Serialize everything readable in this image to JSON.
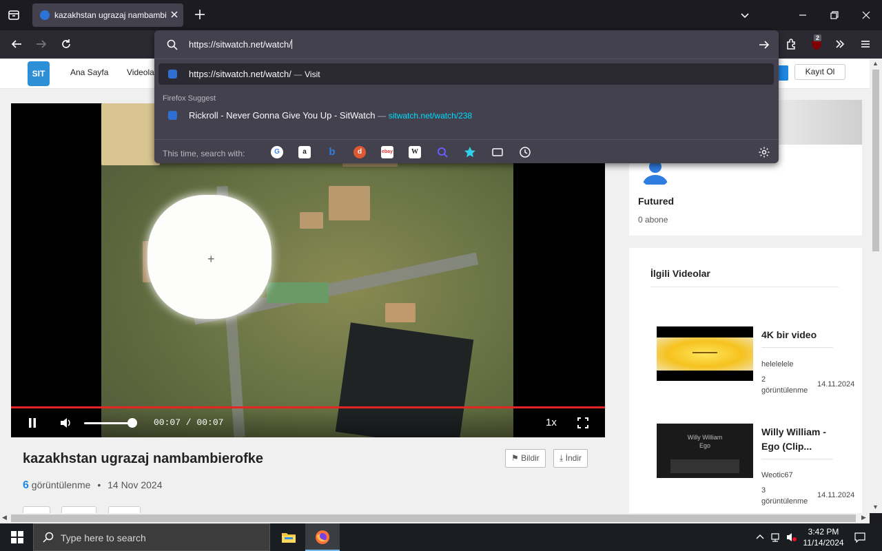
{
  "browser": {
    "tab_title": "kazakhstan ugrazaj nambambierofke",
    "url": "https://sitwatch.net/watch/",
    "extension_badge": "2",
    "results": {
      "visit_url": "https://sitwatch.net/watch/",
      "visit_action": "Visit",
      "suggest_heading": "Firefox Suggest",
      "suggest_title": "Rickroll - Never Gonna Give You Up - SitWatch",
      "suggest_url": "sitwatch.net/watch/238",
      "search_with_label": "This time, search with:"
    }
  },
  "site": {
    "logo_text": "SIT",
    "nav": [
      "Ana Sayfa",
      "Videolar"
    ],
    "register_button": "Kayıt Ol"
  },
  "video": {
    "time": "00:07 / 00:07",
    "speed": "1x",
    "progress": 1.0,
    "volume": 0.9,
    "title": "kazakhstan ugrazaj nambambierofke",
    "report_button": "Bildir",
    "download_button": "İndir",
    "views_count": "6",
    "views_label": "görüntülenme",
    "separator": "•",
    "date": "14 Nov 2024"
  },
  "channel": {
    "name": "Futured",
    "subscribers": "0 abone"
  },
  "related": {
    "heading": "İlgili Videolar",
    "items": [
      {
        "title": "4K bir video",
        "author": "helelelele",
        "views": "2 görüntülenme",
        "date": "14.11.2024"
      },
      {
        "title": "Willy William - Ego (Clip... Officiel)",
        "author": "Weotic67",
        "views": "3 görüntülenme",
        "date": "14.11.2024",
        "thumb_text": "Willy William Ego"
      }
    ]
  },
  "taskbar": {
    "search_placeholder": "Type here to search",
    "time": "3:42 PM",
    "date": "11/14/2024"
  },
  "colors": {
    "accent": "#1e88e5",
    "progress": "#e52521",
    "url_link": "#00ddff"
  }
}
